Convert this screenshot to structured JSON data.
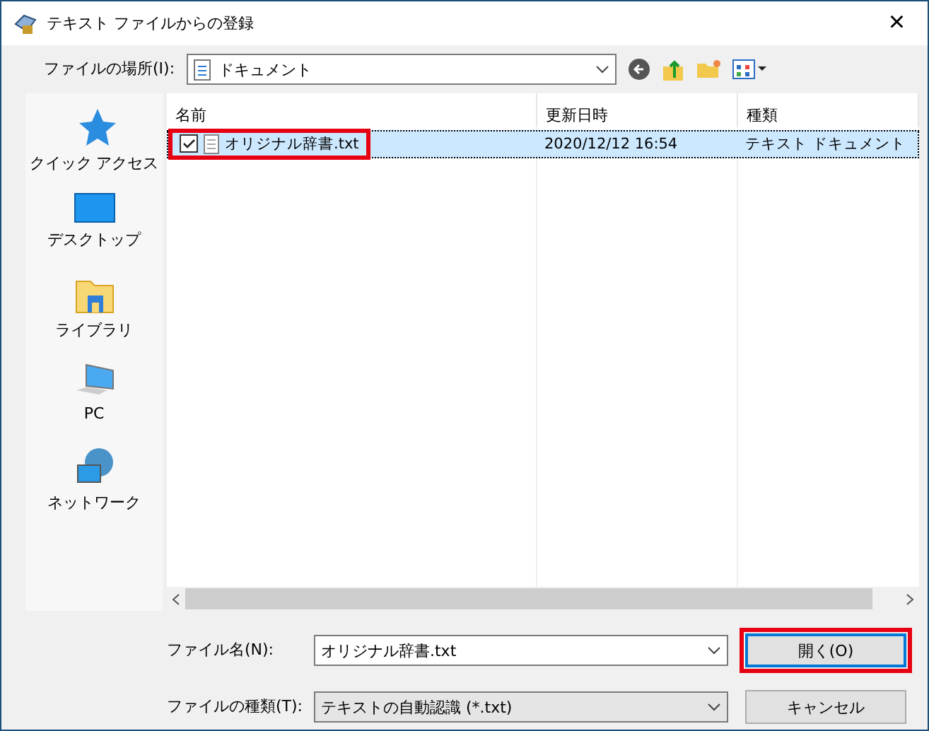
{
  "window": {
    "title": "テキスト ファイルからの登録",
    "close": "×"
  },
  "location": {
    "label": "ファイルの場所(I):",
    "value": "ドキュメント"
  },
  "sidebar": {
    "items": [
      {
        "kind": "star",
        "label": "クイック アクセス"
      },
      {
        "kind": "desktop",
        "label": "デスクトップ"
      },
      {
        "kind": "library",
        "label": "ライブラリ"
      },
      {
        "kind": "pc",
        "label": "PC"
      },
      {
        "kind": "network",
        "label": "ネットワーク"
      }
    ]
  },
  "table": {
    "columns": [
      "名前",
      "更新日時",
      "種類"
    ],
    "rows": [
      {
        "name": "オリジナル辞書.txt",
        "modified": "2020/12/12 16:54",
        "type": "テキスト ドキュメント",
        "checked": true,
        "selected": true,
        "highlighted": true
      }
    ]
  },
  "filename": {
    "label": "ファイル名(N):",
    "value": "オリジナル辞書.txt"
  },
  "filetype": {
    "label": "ファイルの種類(T):",
    "value": "テキストの自動認識 (*.txt)"
  },
  "buttons": [
    {
      "label": "開く(O)",
      "default": true,
      "highlighted": true
    },
    {
      "label": "キャンセル",
      "default": false,
      "highlighted": false
    }
  ]
}
